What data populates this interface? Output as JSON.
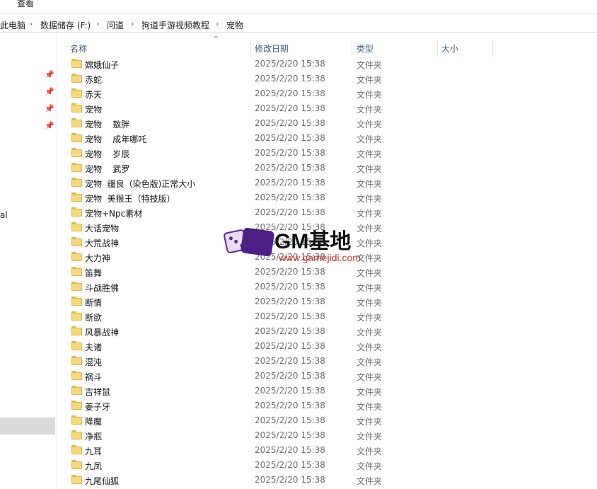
{
  "ribbon": {
    "tab_label": "查看"
  },
  "breadcrumb": {
    "items": [
      "此电脑",
      "数据储存 (F:)",
      "问道",
      "狗道手游视频教程",
      "宠物"
    ],
    "separator": "›"
  },
  "navpane": {
    "partial_label": "al"
  },
  "columns": {
    "name": "名称",
    "date": "修改日期",
    "type": "类型",
    "size": "大小"
  },
  "files": [
    {
      "name": "嫦娥仙子",
      "date": "2025/2/20 15:38",
      "type": "文件夹"
    },
    {
      "name": "赤蛇",
      "date": "2025/2/20 15:38",
      "type": "文件夹"
    },
    {
      "name": "赤天",
      "date": "2025/2/20 15:38",
      "type": "文件夹"
    },
    {
      "name": "宠物",
      "date": "2025/2/20 15:38",
      "type": "文件夹"
    },
    {
      "name": "宠物    敖胖",
      "date": "2025/2/20 15:38",
      "type": "文件夹"
    },
    {
      "name": "宠物    成年哪吒",
      "date": "2025/2/20 15:38",
      "type": "文件夹"
    },
    {
      "name": "宠物    岁辰",
      "date": "2025/2/20 15:38",
      "type": "文件夹"
    },
    {
      "name": "宠物    武罗",
      "date": "2025/2/20 15:38",
      "type": "文件夹"
    },
    {
      "name": "宠物  疆良（染色版)正常大小",
      "date": "2025/2/20 15:38",
      "type": "文件夹"
    },
    {
      "name": "宠物  美猴王（特技版）",
      "date": "2025/2/20 15:38",
      "type": "文件夹"
    },
    {
      "name": "宠物+Npc素材",
      "date": "2025/2/20 15:38",
      "type": "文件夹"
    },
    {
      "name": "大话宠物",
      "date": "2025/2/20 15:38",
      "type": "文件夹"
    },
    {
      "name": "大荒战神",
      "date": "2025/2/20 15:38",
      "type": "文件夹"
    },
    {
      "name": "大力神",
      "date": "2025/2/20 15:38",
      "type": "文件夹"
    },
    {
      "name": "笛舞",
      "date": "2025/2/20 15:38",
      "type": "文件夹"
    },
    {
      "name": "斗战胜佛",
      "date": "2025/2/20 15:38",
      "type": "文件夹"
    },
    {
      "name": "断情",
      "date": "2025/2/20 15:38",
      "type": "文件夹"
    },
    {
      "name": "断欲",
      "date": "2025/2/20 15:38",
      "type": "文件夹"
    },
    {
      "name": "风暴战神",
      "date": "2025/2/20 15:38",
      "type": "文件夹"
    },
    {
      "name": "夫诸",
      "date": "2025/2/20 15:38",
      "type": "文件夹"
    },
    {
      "name": "混沌",
      "date": "2025/2/20 15:38",
      "type": "文件夹"
    },
    {
      "name": "祸斗",
      "date": "2025/2/20 15:38",
      "type": "文件夹"
    },
    {
      "name": "吉祥鼠",
      "date": "2025/2/20 15:38",
      "type": "文件夹"
    },
    {
      "name": "姜子牙",
      "date": "2025/2/20 15:38",
      "type": "文件夹"
    },
    {
      "name": "降魔",
      "date": "2025/2/20 15:38",
      "type": "文件夹"
    },
    {
      "name": "净瓶",
      "date": "2025/2/20 15:38",
      "type": "文件夹"
    },
    {
      "name": "九耳",
      "date": "2025/2/20 15:38",
      "type": "文件夹"
    },
    {
      "name": "九凤",
      "date": "2025/2/20 15:38",
      "type": "文件夹"
    },
    {
      "name": "九尾仙狐",
      "date": "2025/2/20 15:38",
      "type": "文件夹"
    }
  ],
  "watermark": {
    "title": "GM基地",
    "url": "www.gamejidi.com"
  },
  "colors": {
    "folder": "#f7d87c",
    "header_text": "#3e5a7a",
    "selection": "#d9d9d9"
  }
}
